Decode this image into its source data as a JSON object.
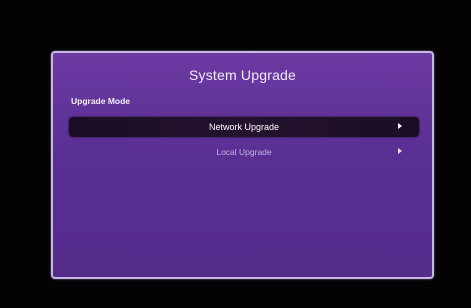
{
  "dialog": {
    "title": "System Upgrade",
    "section_label": "Upgrade Mode"
  },
  "menu": {
    "items": [
      {
        "label": "Network Upgrade",
        "selected": true,
        "icon": "chevron-right-icon"
      },
      {
        "label": "Local Upgrade",
        "selected": false,
        "icon": "chevron-right-icon"
      }
    ]
  },
  "colors": {
    "background": "#040205",
    "dialog_purple": "#5a2f93",
    "dialog_border": "#c9b7e6",
    "selected_row": "#1f1029",
    "text_primary": "#ffffff",
    "text_dim": "#c6b3dd"
  }
}
